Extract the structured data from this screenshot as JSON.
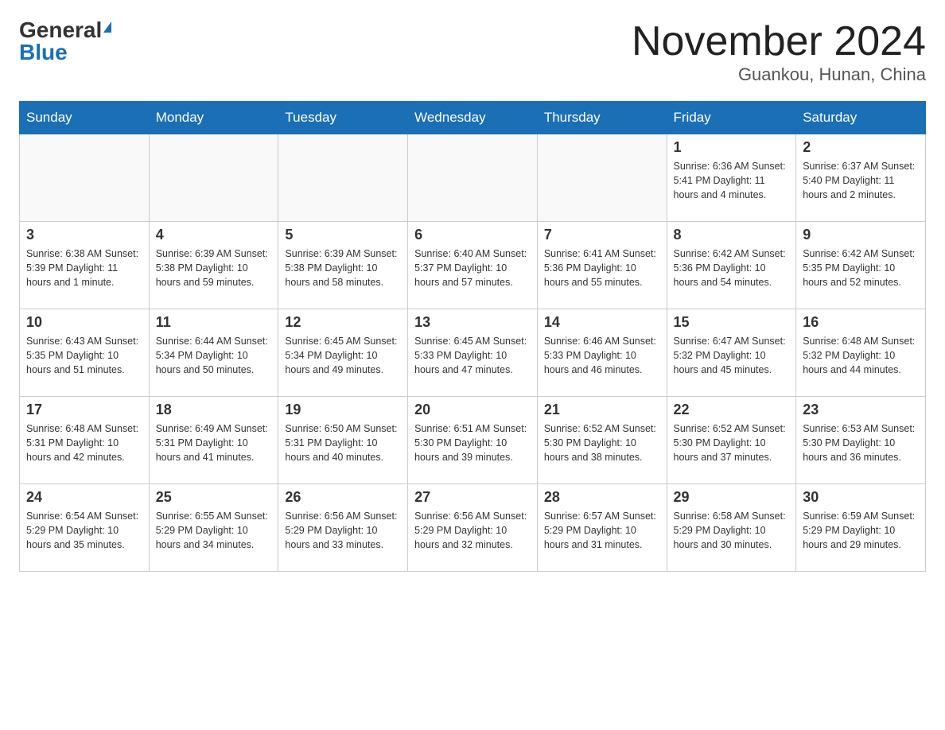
{
  "header": {
    "logo_general": "General",
    "logo_blue": "Blue",
    "title": "November 2024",
    "subtitle": "Guankou, Hunan, China"
  },
  "weekdays": [
    "Sunday",
    "Monday",
    "Tuesday",
    "Wednesday",
    "Thursday",
    "Friday",
    "Saturday"
  ],
  "weeks": [
    [
      {
        "day": "",
        "info": ""
      },
      {
        "day": "",
        "info": ""
      },
      {
        "day": "",
        "info": ""
      },
      {
        "day": "",
        "info": ""
      },
      {
        "day": "",
        "info": ""
      },
      {
        "day": "1",
        "info": "Sunrise: 6:36 AM\nSunset: 5:41 PM\nDaylight: 11 hours and 4 minutes."
      },
      {
        "day": "2",
        "info": "Sunrise: 6:37 AM\nSunset: 5:40 PM\nDaylight: 11 hours and 2 minutes."
      }
    ],
    [
      {
        "day": "3",
        "info": "Sunrise: 6:38 AM\nSunset: 5:39 PM\nDaylight: 11 hours and 1 minute."
      },
      {
        "day": "4",
        "info": "Sunrise: 6:39 AM\nSunset: 5:38 PM\nDaylight: 10 hours and 59 minutes."
      },
      {
        "day": "5",
        "info": "Sunrise: 6:39 AM\nSunset: 5:38 PM\nDaylight: 10 hours and 58 minutes."
      },
      {
        "day": "6",
        "info": "Sunrise: 6:40 AM\nSunset: 5:37 PM\nDaylight: 10 hours and 57 minutes."
      },
      {
        "day": "7",
        "info": "Sunrise: 6:41 AM\nSunset: 5:36 PM\nDaylight: 10 hours and 55 minutes."
      },
      {
        "day": "8",
        "info": "Sunrise: 6:42 AM\nSunset: 5:36 PM\nDaylight: 10 hours and 54 minutes."
      },
      {
        "day": "9",
        "info": "Sunrise: 6:42 AM\nSunset: 5:35 PM\nDaylight: 10 hours and 52 minutes."
      }
    ],
    [
      {
        "day": "10",
        "info": "Sunrise: 6:43 AM\nSunset: 5:35 PM\nDaylight: 10 hours and 51 minutes."
      },
      {
        "day": "11",
        "info": "Sunrise: 6:44 AM\nSunset: 5:34 PM\nDaylight: 10 hours and 50 minutes."
      },
      {
        "day": "12",
        "info": "Sunrise: 6:45 AM\nSunset: 5:34 PM\nDaylight: 10 hours and 49 minutes."
      },
      {
        "day": "13",
        "info": "Sunrise: 6:45 AM\nSunset: 5:33 PM\nDaylight: 10 hours and 47 minutes."
      },
      {
        "day": "14",
        "info": "Sunrise: 6:46 AM\nSunset: 5:33 PM\nDaylight: 10 hours and 46 minutes."
      },
      {
        "day": "15",
        "info": "Sunrise: 6:47 AM\nSunset: 5:32 PM\nDaylight: 10 hours and 45 minutes."
      },
      {
        "day": "16",
        "info": "Sunrise: 6:48 AM\nSunset: 5:32 PM\nDaylight: 10 hours and 44 minutes."
      }
    ],
    [
      {
        "day": "17",
        "info": "Sunrise: 6:48 AM\nSunset: 5:31 PM\nDaylight: 10 hours and 42 minutes."
      },
      {
        "day": "18",
        "info": "Sunrise: 6:49 AM\nSunset: 5:31 PM\nDaylight: 10 hours and 41 minutes."
      },
      {
        "day": "19",
        "info": "Sunrise: 6:50 AM\nSunset: 5:31 PM\nDaylight: 10 hours and 40 minutes."
      },
      {
        "day": "20",
        "info": "Sunrise: 6:51 AM\nSunset: 5:30 PM\nDaylight: 10 hours and 39 minutes."
      },
      {
        "day": "21",
        "info": "Sunrise: 6:52 AM\nSunset: 5:30 PM\nDaylight: 10 hours and 38 minutes."
      },
      {
        "day": "22",
        "info": "Sunrise: 6:52 AM\nSunset: 5:30 PM\nDaylight: 10 hours and 37 minutes."
      },
      {
        "day": "23",
        "info": "Sunrise: 6:53 AM\nSunset: 5:30 PM\nDaylight: 10 hours and 36 minutes."
      }
    ],
    [
      {
        "day": "24",
        "info": "Sunrise: 6:54 AM\nSunset: 5:29 PM\nDaylight: 10 hours and 35 minutes."
      },
      {
        "day": "25",
        "info": "Sunrise: 6:55 AM\nSunset: 5:29 PM\nDaylight: 10 hours and 34 minutes."
      },
      {
        "day": "26",
        "info": "Sunrise: 6:56 AM\nSunset: 5:29 PM\nDaylight: 10 hours and 33 minutes."
      },
      {
        "day": "27",
        "info": "Sunrise: 6:56 AM\nSunset: 5:29 PM\nDaylight: 10 hours and 32 minutes."
      },
      {
        "day": "28",
        "info": "Sunrise: 6:57 AM\nSunset: 5:29 PM\nDaylight: 10 hours and 31 minutes."
      },
      {
        "day": "29",
        "info": "Sunrise: 6:58 AM\nSunset: 5:29 PM\nDaylight: 10 hours and 30 minutes."
      },
      {
        "day": "30",
        "info": "Sunrise: 6:59 AM\nSunset: 5:29 PM\nDaylight: 10 hours and 29 minutes."
      }
    ]
  ]
}
